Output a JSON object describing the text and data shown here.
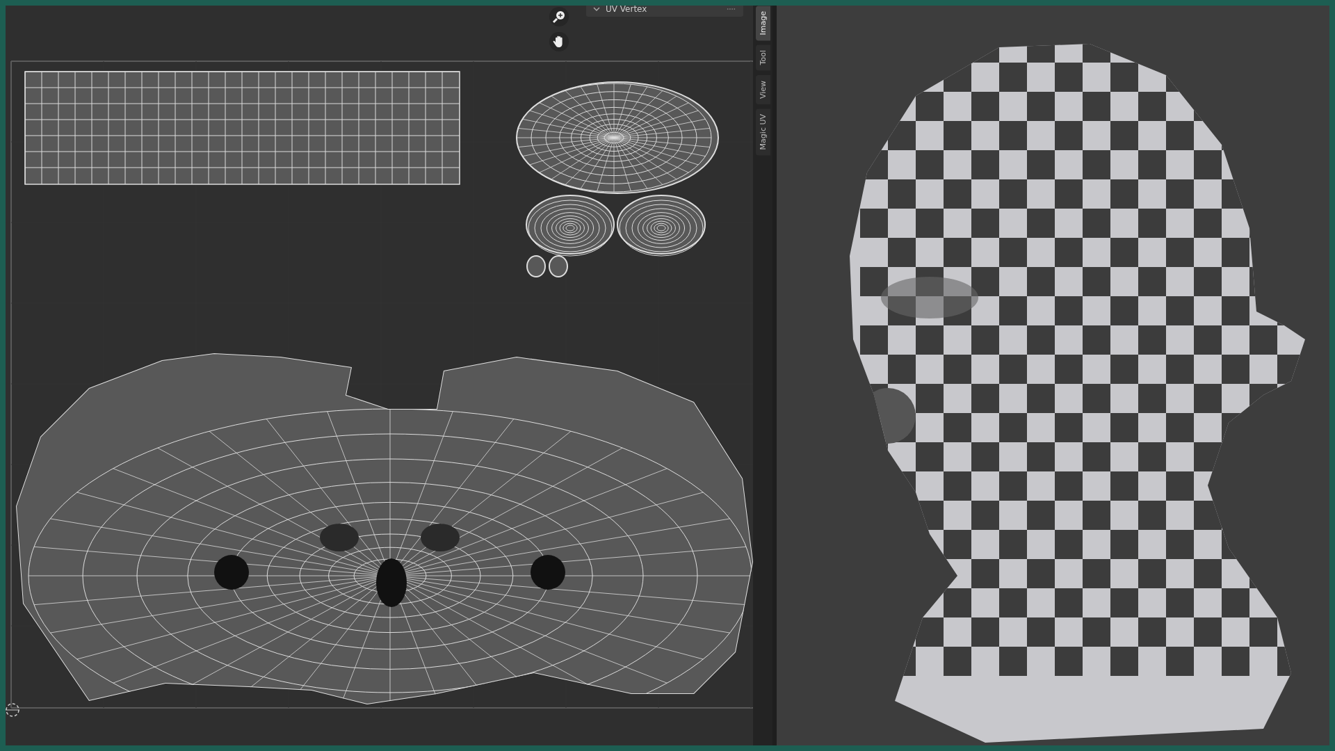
{
  "uv_editor": {
    "panel": {
      "title": "UV Vertex",
      "expanded": true
    }
  },
  "sidebar_tabs": [
    {
      "label": "Image",
      "selected": true
    },
    {
      "label": "Tool",
      "selected": false
    },
    {
      "label": "View",
      "selected": false
    },
    {
      "label": "Magic UV",
      "selected": false
    }
  ]
}
